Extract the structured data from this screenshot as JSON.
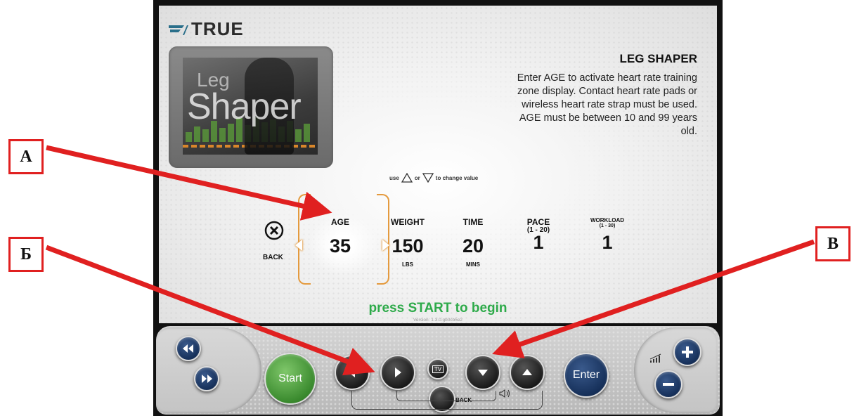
{
  "brand": {
    "logo_text": "TRUE"
  },
  "program": {
    "thumb_word1": "Leg",
    "thumb_word2": "Shaper",
    "title": "LEG SHAPER",
    "description": "Enter AGE to activate heart rate training zone display.  Contact heart rate pads or wireless heart rate strap must be used. AGE must be between 10 and 99 years old."
  },
  "hint": {
    "use": "use",
    "or": "or",
    "to_change": "to change value"
  },
  "back": {
    "label": "BACK"
  },
  "fields": [
    {
      "label": "AGE",
      "sub": "",
      "value": "35",
      "unit": ""
    },
    {
      "label": "WEIGHT",
      "sub": "",
      "value": "150",
      "unit": "LBS"
    },
    {
      "label": "TIME",
      "sub": "",
      "value": "20",
      "unit": "MINS"
    },
    {
      "label": "PACE",
      "sub": "(1 - 20)",
      "value": "1",
      "unit": ""
    },
    {
      "label": "WORKLOAD",
      "sub": "(1 - 30)",
      "value": "1",
      "unit": ""
    }
  ],
  "status": {
    "press": "press START to begin",
    "version": "Version: 1.3.0.gb0cb5e2"
  },
  "controls": {
    "start": "Start",
    "enter": "Enter",
    "back_small": "BACK",
    "tv": "TV"
  },
  "callouts": {
    "a": "А",
    "b": "Б",
    "v": "В"
  },
  "colors": {
    "accent_orange": "#e49a3e",
    "press_green": "#2eaa4a",
    "callout_red": "#e02020",
    "navy": "#16305a"
  }
}
